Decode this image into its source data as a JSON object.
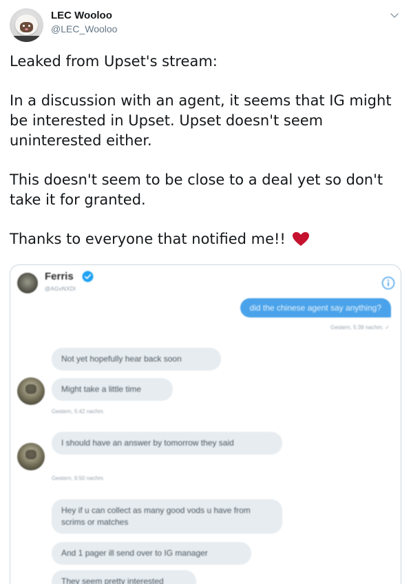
{
  "author": {
    "display_name": "LEC Wooloo",
    "handle": "@LEC_Wooloo",
    "avatar_icon": "wooloo-sheep-avatar"
  },
  "tweet": {
    "paragraphs": [
      "Leaked from Upset's stream:",
      "In a discussion with an agent, it seems that IG might be interested in Upset. Upset doesn't seem uninterested either.",
      "This doesn't seem to be close to a deal yet so don't take it for granted.",
      "Thanks to everyone that notified me!!"
    ],
    "emoji": "red-heart-icon"
  },
  "media": {
    "dm_header": {
      "name": "Ferris",
      "handle": "@AGvNXDI",
      "verified": true
    },
    "messages": [
      {
        "direction": "out",
        "text": "did the chinese agent say anything?"
      },
      {
        "direction": "out_timestamp",
        "text": "Gestern, 5:39 nachm. ✓"
      },
      {
        "direction": "in",
        "text": "Not yet hopefully hear back soon"
      },
      {
        "direction": "in",
        "text": "Might take a little time"
      },
      {
        "direction": "in_timestamp",
        "text": "Gestern, 5:42 nachm."
      },
      {
        "direction": "in",
        "text": "I should have an answer by tomorrow they said"
      },
      {
        "direction": "in_timestamp",
        "text": "Gestern, 6:50 nachm."
      },
      {
        "direction": "in",
        "text": "Hey if u can collect as many good vods u have from scrims or matches"
      },
      {
        "direction": "in",
        "text": "And 1 pager ill send over to IG manager"
      },
      {
        "direction": "in",
        "text": "They seem pretty interested"
      }
    ]
  },
  "colors": {
    "accent_blue": "#1da1f2",
    "heart_red": "#c4122f",
    "text_primary": "#14171a",
    "text_secondary": "#657786"
  }
}
